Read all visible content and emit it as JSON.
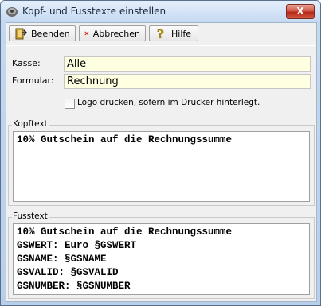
{
  "window": {
    "title": "Kopf- und Fusstexte einstellen",
    "close_label": "X"
  },
  "toolbar": {
    "beenden_label": "Beenden",
    "abbrechen_label": "Abbrechen",
    "hilfe_label": "Hilfe"
  },
  "form": {
    "kasse_label": "Kasse:",
    "kasse_value": "Alle",
    "formular_label": "Formular:",
    "formular_value": "Rechnung",
    "logo_checkbox_label": "Logo drucken, sofern im Drucker hinterlegt.",
    "logo_checked": false
  },
  "kopftext": {
    "caption": "Kopftext",
    "lines": [
      "10% Gutschein auf die Rechnungssumme"
    ]
  },
  "fusstext": {
    "caption": "Fusstext",
    "lines": [
      "10% Gutschein auf die Rechnungssumme",
      "GSWERT: Euro §GSWERT",
      "GSNAME: §GSNAME",
      "GSVALID: §GSVALID",
      "GSNUMBER: §GSNUMBER"
    ]
  },
  "colors": {
    "field_bg": "#ffffe1",
    "close_red": "#c43b2c"
  },
  "icons": [
    "app-icon",
    "exit-door-icon",
    "cancel-x-icon",
    "help-question-icon"
  ]
}
